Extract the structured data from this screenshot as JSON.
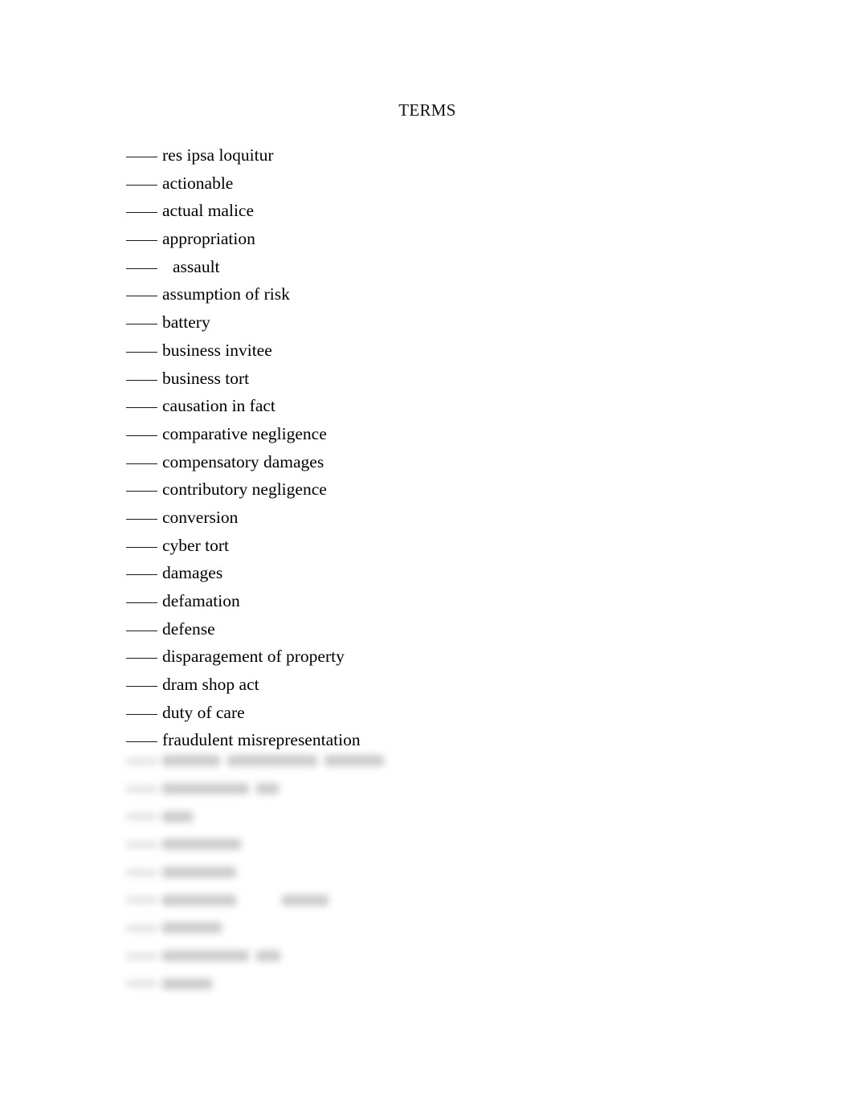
{
  "document": {
    "title": "TERMS",
    "page_background": "#ffffff",
    "text_color": "#000000",
    "blank_prefix": "____"
  },
  "terms": [
    {
      "label": "res ipsa loquitur",
      "indented": false
    },
    {
      "label": "actionable",
      "indented": false
    },
    {
      "label": "actual malice",
      "indented": false
    },
    {
      "label": "appropriation",
      "indented": false
    },
    {
      "label": "assault",
      "indented": true
    },
    {
      "label": "assumption of risk",
      "indented": false
    },
    {
      "label": "battery",
      "indented": false
    },
    {
      "label": "business invitee",
      "indented": false
    },
    {
      "label": "business tort",
      "indented": false
    },
    {
      "label": "causation in fact",
      "indented": false
    },
    {
      "label": "comparative negligence",
      "indented": false
    },
    {
      "label": "compensatory damages",
      "indented": false
    },
    {
      "label": "contributory negligence",
      "indented": false
    },
    {
      "label": "conversion",
      "indented": false
    },
    {
      "label": "cyber tort",
      "indented": false
    },
    {
      "label": "damages",
      "indented": false
    },
    {
      "label": "defamation",
      "indented": false
    },
    {
      "label": "defense",
      "indented": false
    },
    {
      "label": "disparagement of property",
      "indented": false
    },
    {
      "label": "dram shop act",
      "indented": false
    },
    {
      "label": "duty of care",
      "indented": false
    },
    {
      "label": "fraudulent misrepresentation",
      "indented": false
    }
  ],
  "blurred_rows": [
    {
      "words": [
        72,
        112,
        74
      ]
    },
    {
      "words": [
        108,
        28
      ]
    },
    {
      "words": [
        38
      ]
    },
    {
      "words": [
        98
      ]
    },
    {
      "words": [
        92
      ]
    },
    {
      "words": [
        92,
        0,
        58
      ]
    },
    {
      "words": [
        74
      ]
    },
    {
      "words": [
        108,
        30
      ]
    },
    {
      "words": [
        62
      ]
    }
  ]
}
